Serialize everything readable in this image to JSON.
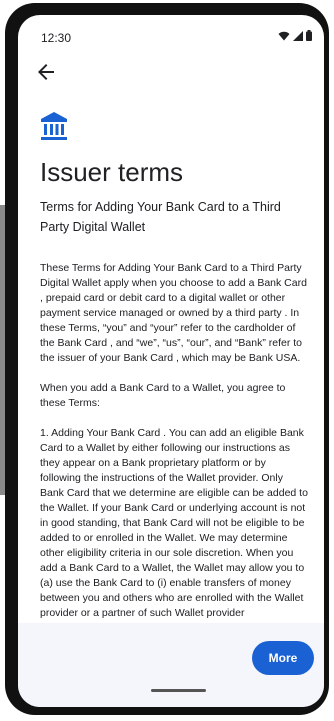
{
  "status_bar": {
    "time": "12:30"
  },
  "header": {
    "title": "Issuer terms",
    "subtitle": "Terms for Adding Your Bank Card to a Third Party Digital Wallet"
  },
  "content": {
    "paragraph_1": "These Terms for Adding Your Bank Card to a Third Party Digital Wallet apply when you choose to add a Bank Card , prepaid card or debit card to a digital wallet or other payment service managed or owned by a third party . In these Terms, “you” and “your” refer to the cardholder of the Bank Card , and “we”, “us”, “our”, and “Bank” refer to the issuer of your Bank Card , which may be Bank USA.",
    "paragraph_2": "When you add a Bank Card  to a Wallet, you agree to these Terms:",
    "paragraph_3": "1. Adding Your Bank Card . You can add an eligible Bank Card  to a Wallet by either following our instructions as they appear on a Bank proprietary platform or by following the instructions of the Wallet provider. Only Bank Card that we determine are eligible can be added to the Wallet. If your Bank Card or underlying account is not in good standing, that Bank Card will not be eligible to be added to or enrolled in the Wallet. We may determine other eligibility criteria in our sole discretion. When you add a Bank Card to a Wallet, the Wallet may allow you to (a) use the Bank Card to (i) enable transfers of money between you and others who are enrolled with the Wallet provider or a partner of such Wallet provider"
  },
  "footer": {
    "more_label": "More"
  },
  "icons": {
    "back": "arrow-back-icon",
    "bank": "bank-icon",
    "wifi": "wifi-icon",
    "signal": "signal-icon",
    "battery": "battery-icon"
  },
  "colors": {
    "accent": "#1a61d4",
    "icon_blue": "#1a61d4"
  }
}
